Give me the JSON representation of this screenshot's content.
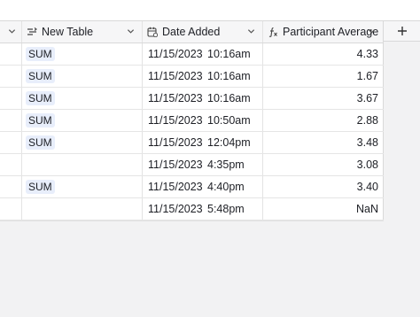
{
  "columns": {
    "new_table": "New Table",
    "date_added": "Date Added",
    "participant_average": "Participant Average"
  },
  "add_column_icon": "plus-icon",
  "rows": [
    {
      "link": "SUM",
      "date": "11/15/2023",
      "time": "10:16am",
      "average": "4.33"
    },
    {
      "link": "SUM",
      "date": "11/15/2023",
      "time": "10:16am",
      "average": "1.67"
    },
    {
      "link": "SUM",
      "date": "11/15/2023",
      "time": "10:16am",
      "average": "3.67"
    },
    {
      "link": "SUM",
      "date": "11/15/2023",
      "time": "10:50am",
      "average": "2.88"
    },
    {
      "link": "SUM",
      "date": "11/15/2023",
      "time": "12:04pm",
      "average": "3.48"
    },
    {
      "link": "",
      "date": "11/15/2023",
      "time": "4:35pm",
      "average": "3.08"
    },
    {
      "link": "SUM",
      "date": "11/15/2023",
      "time": "4:40pm",
      "average": "3.40"
    },
    {
      "link": "",
      "date": "11/15/2023",
      "time": "5:48pm",
      "average": "NaN"
    }
  ],
  "colors": {
    "header_bg": "#f6f6f7",
    "pill_bg": "#e8eefb",
    "canvas_bg": "#f2f2f3"
  }
}
